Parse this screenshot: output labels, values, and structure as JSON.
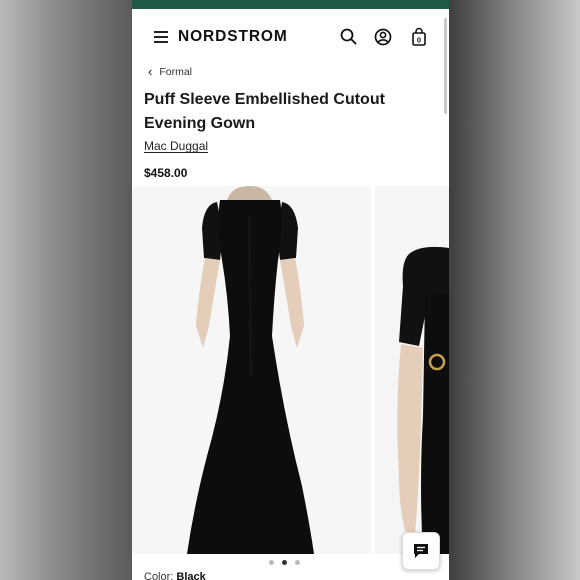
{
  "header": {
    "brand": "NORDSTROM",
    "icons": [
      "menu-icon",
      "search-icon",
      "account-icon",
      "bag-icon"
    ],
    "bag_count": "0"
  },
  "breadcrumb": {
    "label": "Formal"
  },
  "product": {
    "title": "Puff Sleeve Embellished Cutout Evening Gown",
    "designer": "Mac Duggal",
    "price": "$458.00",
    "color_label": "Color:",
    "color_value": "Black"
  },
  "gallery": {
    "image_count": 3,
    "active_index": 1
  },
  "colors": {
    "topbar": "#1f5a45",
    "dress": "#0d0d0d"
  }
}
